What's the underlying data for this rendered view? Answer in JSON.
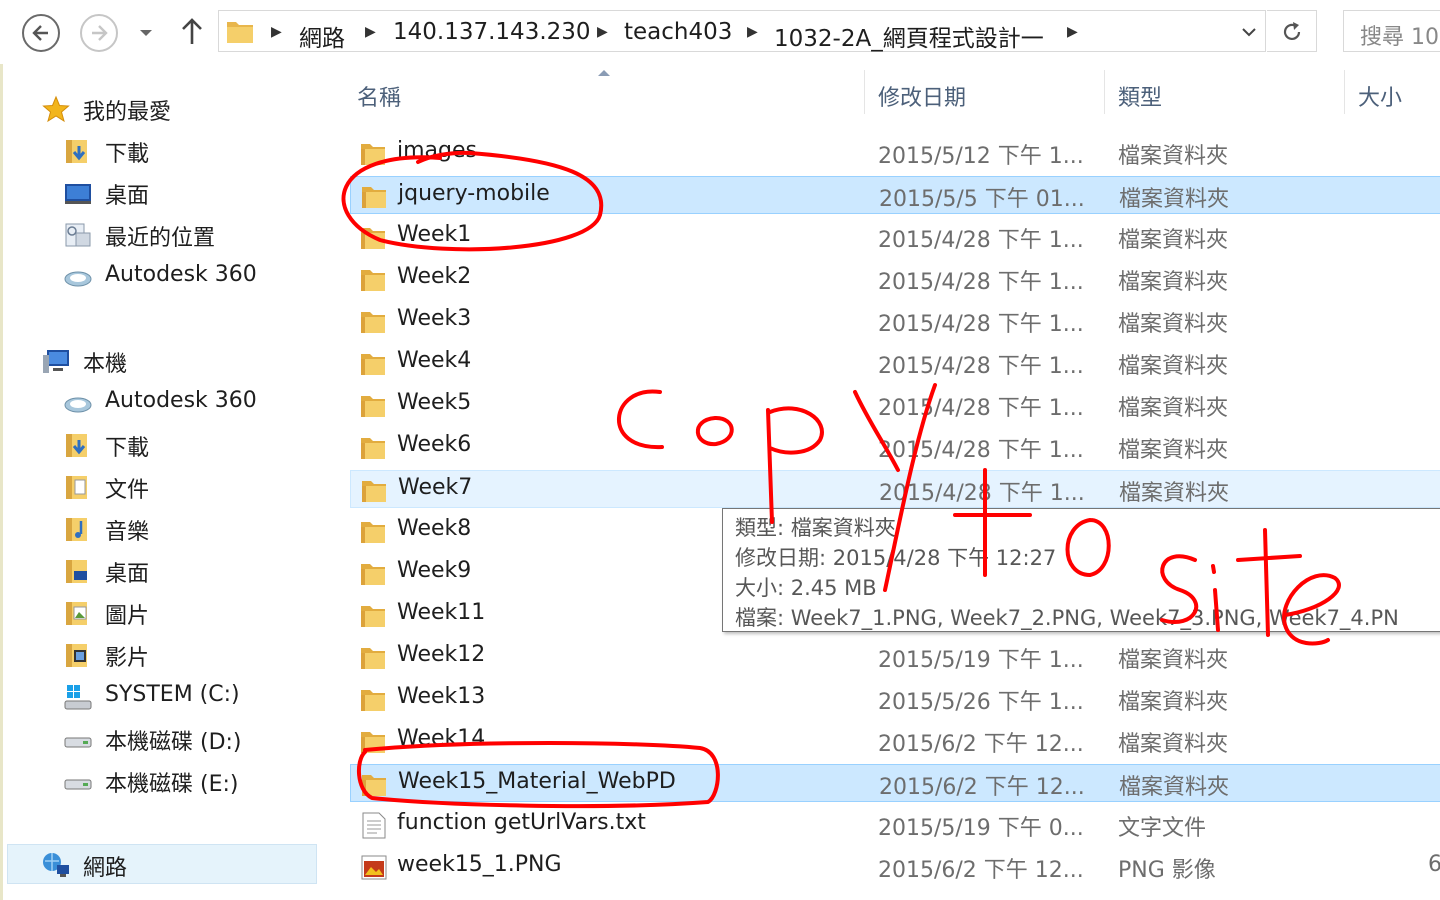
{
  "nav": {
    "back_icon": "back-arrow-icon",
    "forward_icon": "forward-arrow-icon",
    "recent_icon": "chevron-down-icon",
    "up_icon": "up-arrow-icon"
  },
  "address": {
    "crumbs": [
      "網路",
      "140.137.143.230",
      "teach403",
      "1032-2A_網頁程式設計一"
    ],
    "refresh_icon": "refresh-icon"
  },
  "search": {
    "placeholder": "搜尋 10"
  },
  "sidebar": {
    "favorites": {
      "label": "我的最愛",
      "items": [
        {
          "label": "下載",
          "icon": "downloads-folder-icon"
        },
        {
          "label": "桌面",
          "icon": "desktop-icon"
        },
        {
          "label": "最近的位置",
          "icon": "recent-places-icon"
        },
        {
          "label": "Autodesk 360",
          "icon": "cloud-icon"
        }
      ]
    },
    "this_pc": {
      "label": "本機",
      "items": [
        {
          "label": "Autodesk 360",
          "icon": "cloud-icon"
        },
        {
          "label": "下載",
          "icon": "downloads-folder-icon"
        },
        {
          "label": "文件",
          "icon": "documents-folder-icon"
        },
        {
          "label": "音樂",
          "icon": "music-folder-icon"
        },
        {
          "label": "桌面",
          "icon": "desktop-folder-icon"
        },
        {
          "label": "圖片",
          "icon": "pictures-folder-icon"
        },
        {
          "label": "影片",
          "icon": "videos-folder-icon"
        },
        {
          "label": "SYSTEM (C:)",
          "icon": "system-drive-icon"
        },
        {
          "label": "本機磁碟 (D:)",
          "icon": "drive-icon"
        },
        {
          "label": "本機磁碟 (E:)",
          "icon": "drive-icon"
        }
      ]
    },
    "network": {
      "label": "網路",
      "icon": "network-icon"
    }
  },
  "columns": {
    "name": "名稱",
    "date": "修改日期",
    "type": "類型",
    "size": "大小"
  },
  "files": [
    {
      "name": "images",
      "date": "2015/5/12 下午 1...",
      "type": "檔案資料夾",
      "size": "",
      "icon": "folder-icon"
    },
    {
      "name": "jquery-mobile",
      "date": "2015/5/5 下午 01...",
      "type": "檔案資料夾",
      "size": "",
      "icon": "folder-icon",
      "selected": true
    },
    {
      "name": "Week1",
      "date": "2015/4/28 下午 1...",
      "type": "檔案資料夾",
      "size": "",
      "icon": "folder-icon"
    },
    {
      "name": "Week2",
      "date": "2015/4/28 下午 1...",
      "type": "檔案資料夾",
      "size": "",
      "icon": "folder-icon"
    },
    {
      "name": "Week3",
      "date": "2015/4/28 下午 1...",
      "type": "檔案資料夾",
      "size": "",
      "icon": "folder-icon"
    },
    {
      "name": "Week4",
      "date": "2015/4/28 下午 1...",
      "type": "檔案資料夾",
      "size": "",
      "icon": "folder-icon"
    },
    {
      "name": "Week5",
      "date": "2015/4/28 下午 1...",
      "type": "檔案資料夾",
      "size": "",
      "icon": "folder-icon"
    },
    {
      "name": "Week6",
      "date": "2015/4/28 下午 1...",
      "type": "檔案資料夾",
      "size": "",
      "icon": "folder-icon"
    },
    {
      "name": "Week7",
      "date": "2015/4/28 下午 1...",
      "type": "檔案資料夾",
      "size": "",
      "icon": "folder-icon",
      "hover": true
    },
    {
      "name": "Week8",
      "date": "",
      "type": "",
      "size": "",
      "icon": "folder-icon"
    },
    {
      "name": "Week9",
      "date": "",
      "type": "",
      "size": "",
      "icon": "folder-icon"
    },
    {
      "name": "Week11",
      "date": "",
      "type": "",
      "size": "",
      "icon": "folder-icon"
    },
    {
      "name": "Week12",
      "date": "2015/5/19 下午 1...",
      "type": "檔案資料夾",
      "size": "",
      "icon": "folder-icon"
    },
    {
      "name": "Week13",
      "date": "2015/5/26 下午 1...",
      "type": "檔案資料夾",
      "size": "",
      "icon": "folder-icon"
    },
    {
      "name": "Week14",
      "date": "2015/6/2 下午 12...",
      "type": "檔案資料夾",
      "size": "",
      "icon": "folder-icon"
    },
    {
      "name": "Week15_Material_WebPD",
      "date": "2015/6/2 下午 12...",
      "type": "檔案資料夾",
      "size": "",
      "icon": "folder-icon",
      "selected": true
    },
    {
      "name": "function getUrlVars.txt",
      "date": "2015/5/19 下午 0...",
      "type": "文字文件",
      "size": "",
      "icon": "text-file-icon"
    },
    {
      "name": "week15_1.PNG",
      "date": "2015/6/2 下午 12...",
      "type": "PNG 影像",
      "size": "6",
      "icon": "image-file-icon"
    }
  ],
  "tooltip": {
    "type_line": "類型: 檔案資料夾",
    "date_line": "修改日期: 2015/4/28 下午 12:27",
    "size_line": "大小: 2.45 MB",
    "files_line": "檔案: Week7_1.PNG, Week7_2.PNG, Week7_3.PNG, Week7_4.PN"
  },
  "annotations": {
    "handwritten_text": "copy to site",
    "ink_color": "#ff0000"
  }
}
